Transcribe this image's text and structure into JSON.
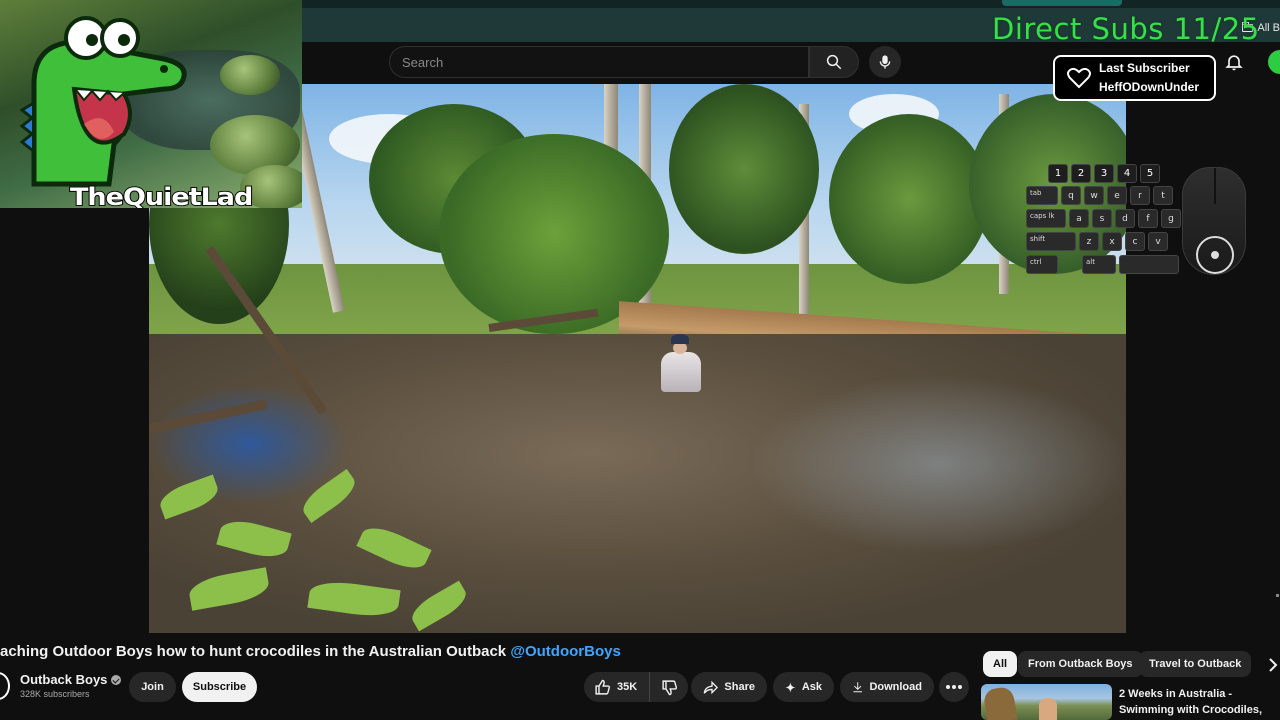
{
  "browser": {
    "bookmarks_label": "All B"
  },
  "overlay": {
    "direct_subs": "Direct Subs 11/25",
    "last_subscriber_label": "Last Subscriber",
    "last_subscriber_name": "HeffODownUnder",
    "webcam_name": "TheQuietLad",
    "keyboard_rows": [
      [
        "1",
        "2",
        "3",
        "4",
        "5"
      ],
      [
        "tab",
        "q",
        "w",
        "e",
        "r",
        "t"
      ],
      [
        "caps lk",
        "a",
        "s",
        "d",
        "f",
        "g"
      ],
      [
        "shift",
        "z",
        "x",
        "c",
        "v"
      ],
      [
        "ctrl",
        "alt"
      ]
    ],
    "colors": {
      "subs_green": "#35e04a"
    }
  },
  "header": {
    "search_placeholder": "Search"
  },
  "video": {
    "title_prefix": "aching Outdoor Boys how to hunt crocodiles in the Australian Outback",
    "title_handle": "@OutdoorBoys"
  },
  "channel": {
    "name": "Outback Boys",
    "subscribers": "328K subscribers",
    "join_label": "Join",
    "subscribe_label": "Subscribe"
  },
  "actions": {
    "like_count": "35K",
    "share_label": "Share",
    "ask_label": "Ask",
    "download_label": "Download"
  },
  "sidebar": {
    "chips": [
      "All",
      "From Outback Boys",
      "Travel to Outback"
    ],
    "recommendation": {
      "title": "2 Weeks in Australia - Swimming with Crocodiles, ..."
    }
  },
  "colors": {
    "background": "#0f0f0f",
    "link": "#3ea6ff",
    "chip_bg": "#272727"
  }
}
